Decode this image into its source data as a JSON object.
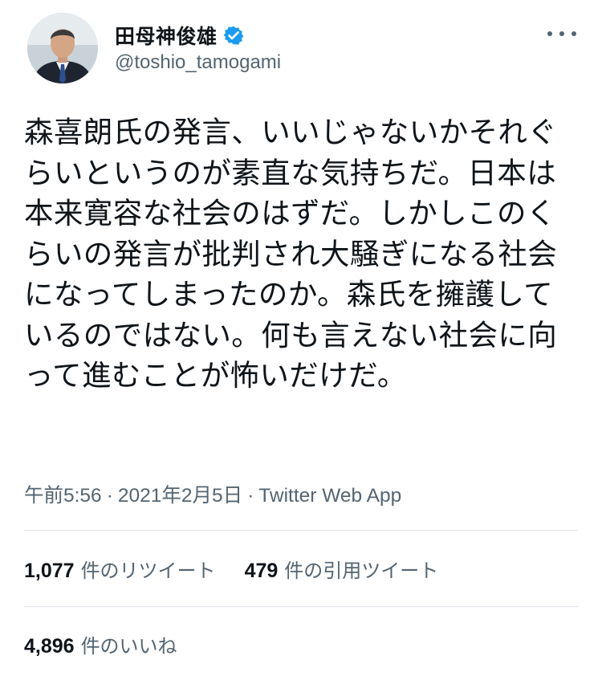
{
  "author": {
    "display_name": "田母神俊雄",
    "handle": "@toshio_tamogami",
    "verified": true,
    "avatar_icon": "avatar-portrait-icon",
    "verified_icon": "verified-badge-icon",
    "verified_color": "#1d9bf0"
  },
  "more_icon": "more-horizontal-icon",
  "tweet": {
    "text": "森喜朗氏の発言、いいじゃないかそれぐらいというのが素直な気持ちだ。日本は本来寛容な社会のはずだ。しかしこのくらいの発言が批判され大騒ぎになる社会になってしまったのか。森氏を擁護しているのではない。何も言えない社会に向って進むことが怖いだけだ。"
  },
  "meta": {
    "time": "午前5:56",
    "separator": "·",
    "date": "2021年2月5日",
    "source": "Twitter Web App"
  },
  "stats": {
    "retweets": {
      "count": "1,077",
      "label": "件のリツイート"
    },
    "quotes": {
      "count": "479",
      "label": "件の引用ツイート"
    },
    "likes": {
      "count": "4,896",
      "label": "件のいいね"
    }
  },
  "colors": {
    "text": "#0f1419",
    "secondary": "#536471",
    "divider": "#dfe3e7"
  }
}
